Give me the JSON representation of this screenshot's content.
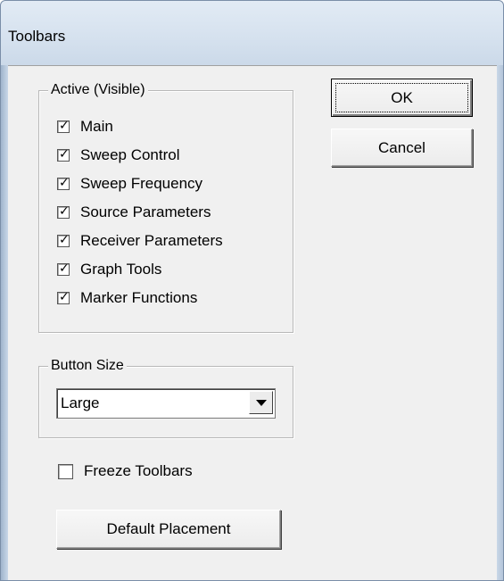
{
  "window": {
    "title": "Toolbars"
  },
  "active_group": {
    "label": "Active (Visible)",
    "items": [
      {
        "label": "Main",
        "checked": true
      },
      {
        "label": "Sweep Control",
        "checked": true
      },
      {
        "label": "Sweep Frequency",
        "checked": true
      },
      {
        "label": "Source Parameters",
        "checked": true
      },
      {
        "label": "Receiver Parameters",
        "checked": true
      },
      {
        "label": "Graph Tools",
        "checked": true
      },
      {
        "label": "Marker Functions",
        "checked": true
      }
    ],
    "check_glyph": "✓"
  },
  "buttons": {
    "ok_label": "OK",
    "cancel_label": "Cancel",
    "default_placement_label": "Default Placement"
  },
  "button_size_group": {
    "label": "Button Size",
    "selected": "Large"
  },
  "freeze": {
    "label": "Freeze Toolbars",
    "checked": false
  }
}
